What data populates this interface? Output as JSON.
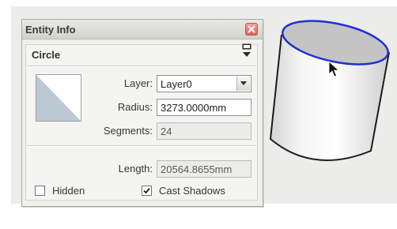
{
  "dialog": {
    "title": "Entity Info",
    "entity_type": "Circle",
    "fields": {
      "layer": {
        "label": "Layer:",
        "value": "Layer0"
      },
      "radius": {
        "label": "Radius:",
        "value": "3273.0000mm"
      },
      "segments": {
        "label": "Segments:",
        "value": "24"
      },
      "length": {
        "label": "Length:",
        "value": "20564.8655mm"
      }
    },
    "checkboxes": {
      "hidden": {
        "label": "Hidden",
        "checked": false
      },
      "cast_shadows": {
        "label": "Cast Shadows",
        "checked": true
      }
    }
  },
  "icons": {
    "close": "close-icon",
    "toggle": "panel-toggle-icon",
    "dropdown": "chevron-down-icon",
    "cursor": "arrow-cursor-icon"
  },
  "colors": {
    "edge_selected": "#1f2fd1",
    "close_button": "#d8665e",
    "swatch_fill": "#bcc8d4"
  }
}
